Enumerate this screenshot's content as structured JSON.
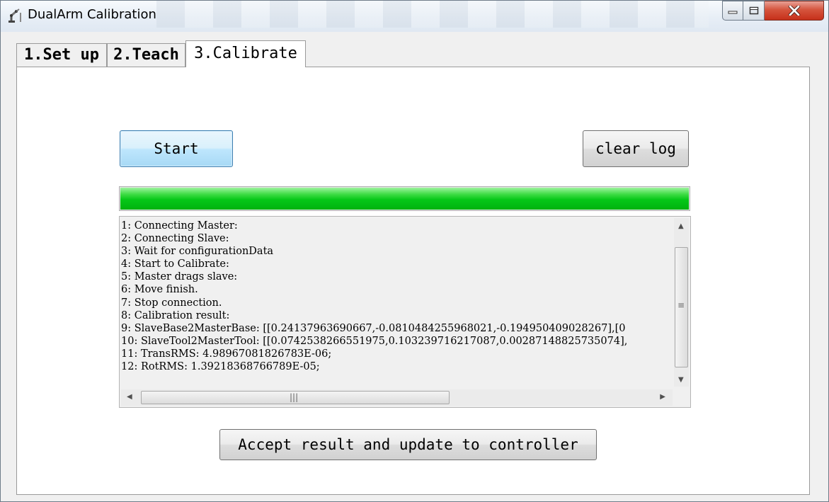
{
  "window": {
    "title": "DualArm Calibration",
    "controls": {
      "minimize": "minimize",
      "maximize": "maximize",
      "close": "close"
    }
  },
  "tabs": [
    {
      "label": "1.Set up",
      "active": false
    },
    {
      "label": "2.Teach",
      "active": false
    },
    {
      "label": "3.Calibrate",
      "active": true
    }
  ],
  "buttons": {
    "start": "Start",
    "clear_log": "clear log",
    "accept": "Accept result and update to controller"
  },
  "progress": {
    "value": 1.0,
    "color": "#06c718"
  },
  "log": {
    "lines": [
      "1: Connecting Master:",
      "2: Connecting Slave:",
      "3: Wait for configurationData",
      "4: Start to Calibrate:",
      "5: Master drags slave:",
      "6: Move finish.",
      "7: Stop connection.",
      "8: Calibration result:",
      "9: SlaveBase2MasterBase: [[0.24137963690667,-0.0810484255968021,-0.194950409028267],[0",
      "10: SlaveTool2MasterTool: [[0.0742538266551975,0.103239716217087,0.00287148825735074],",
      "11: TransRMS: 4.98967081826783E-06;",
      "12: RotRMS: 1.39218368766789E-05;"
    ]
  },
  "icons": {
    "app": "robot-arm-icon",
    "scroll_up": "arrow-up-icon",
    "scroll_down": "arrow-down-icon",
    "scroll_left": "arrow-left-icon",
    "scroll_right": "arrow-right-icon"
  }
}
